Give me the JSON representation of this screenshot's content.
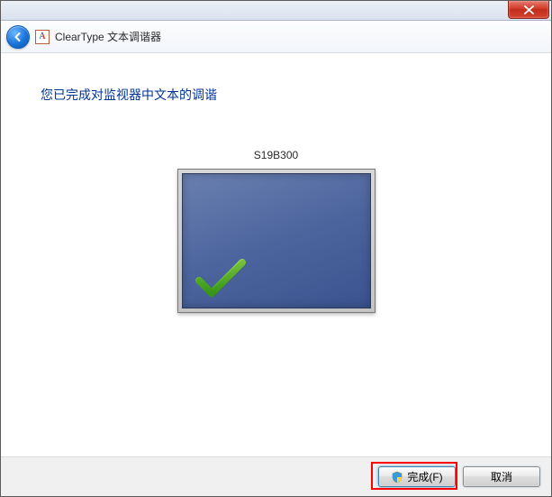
{
  "header": {
    "title": "ClearType 文本调谐器"
  },
  "content": {
    "heading": "您已完成对监视器中文本的调谐",
    "monitor_label": "S19B300"
  },
  "footer": {
    "finish_label": "完成(F)",
    "cancel_label": "取消"
  }
}
